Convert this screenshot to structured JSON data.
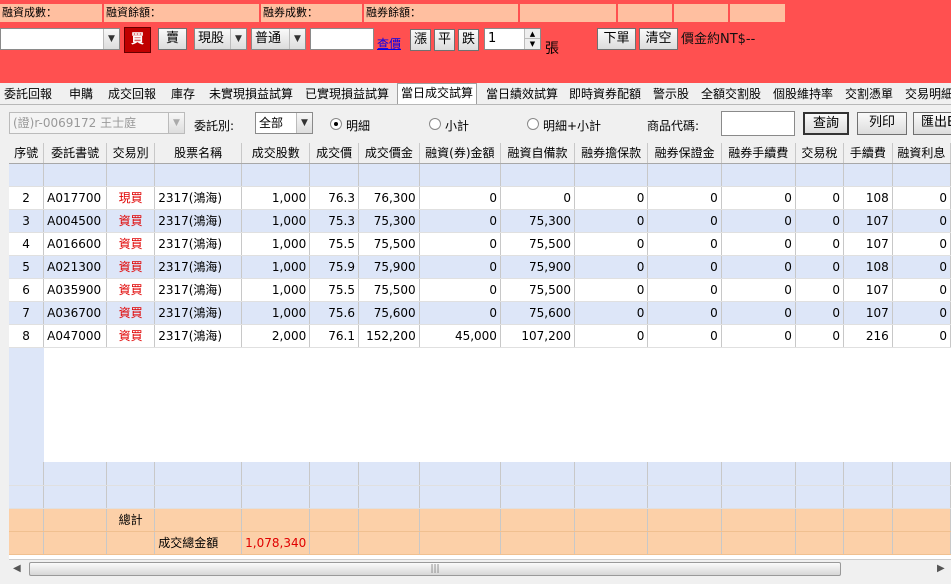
{
  "order_panel": {
    "info": [
      "融資成數：",
      "融資餘額：",
      "融券成數：",
      "融券餘額："
    ],
    "buy": "買",
    "sell": "賣",
    "trade_type": "現股",
    "order_type": "普通",
    "price_link": "查價",
    "up": "漲",
    "flat": "平",
    "down": "跌",
    "quantity": "1",
    "unit": "張",
    "place_order": "下單",
    "clear": "清空",
    "price_note": "價金約NT$--"
  },
  "tabs": [
    "委託回報",
    "申購",
    "成交回報",
    "庫存",
    "未實現損益試算",
    "已實現損益試算",
    "當日成交試算",
    "當日績效試算",
    "即時資券配額",
    "警示股",
    "全額交割股",
    "個股維持率",
    "交割憑單",
    "交易明細"
  ],
  "active_tab": "當日成交試算",
  "filter": {
    "account": "(證)r-0069172 王士庭",
    "delegate_label": "委託別:",
    "delegate_value": "全部",
    "radio_detail": "明細",
    "radio_subtotal": "小計",
    "radio_both": "明細+小計",
    "code_label": "商品代碼:",
    "query": "查詢",
    "print": "列印",
    "export": "匯出EXCEL"
  },
  "table": {
    "headers": [
      "序號",
      "委託書號",
      "交易別",
      "股票名稱",
      "成交股數",
      "成交價",
      "成交價金",
      "融資(券)金額",
      "融資自備款",
      "融券擔保款",
      "融券保證金",
      "融券手續費",
      "交易稅",
      "手續費",
      "融資利息"
    ],
    "rows": [
      [
        "2",
        "A017700",
        "現買",
        "2317(鴻海)",
        "1,000",
        "76.3",
        "76,300",
        "0",
        "0",
        "0",
        "0",
        "0",
        "0",
        "108",
        "0"
      ],
      [
        "3",
        "A004500",
        "資買",
        "2317(鴻海)",
        "1,000",
        "75.3",
        "75,300",
        "0",
        "75,300",
        "0",
        "0",
        "0",
        "0",
        "107",
        "0"
      ],
      [
        "4",
        "A016600",
        "資買",
        "2317(鴻海)",
        "1,000",
        "75.5",
        "75,500",
        "0",
        "75,500",
        "0",
        "0",
        "0",
        "0",
        "107",
        "0"
      ],
      [
        "5",
        "A021300",
        "資買",
        "2317(鴻海)",
        "1,000",
        "75.9",
        "75,900",
        "0",
        "75,900",
        "0",
        "0",
        "0",
        "0",
        "108",
        "0"
      ],
      [
        "6",
        "A035900",
        "資買",
        "2317(鴻海)",
        "1,000",
        "75.5",
        "75,500",
        "0",
        "75,500",
        "0",
        "0",
        "0",
        "0",
        "107",
        "0"
      ],
      [
        "7",
        "A036700",
        "資買",
        "2317(鴻海)",
        "1,000",
        "75.6",
        "75,600",
        "0",
        "75,600",
        "0",
        "0",
        "0",
        "0",
        "107",
        "0"
      ],
      [
        "8",
        "A047000",
        "資買",
        "2317(鴻海)",
        "2,000",
        "76.1",
        "152,200",
        "45,000",
        "107,200",
        "0",
        "0",
        "0",
        "0",
        "216",
        "0"
      ]
    ],
    "summary_label": "總計",
    "total_label": "成交總金額",
    "total_value": "1,078,340"
  },
  "colors": {
    "panel_red": "#ff5050",
    "row_blue": "#dde6f8",
    "summary_peach": "#fcd0a8",
    "trade_red": "#e00000"
  }
}
